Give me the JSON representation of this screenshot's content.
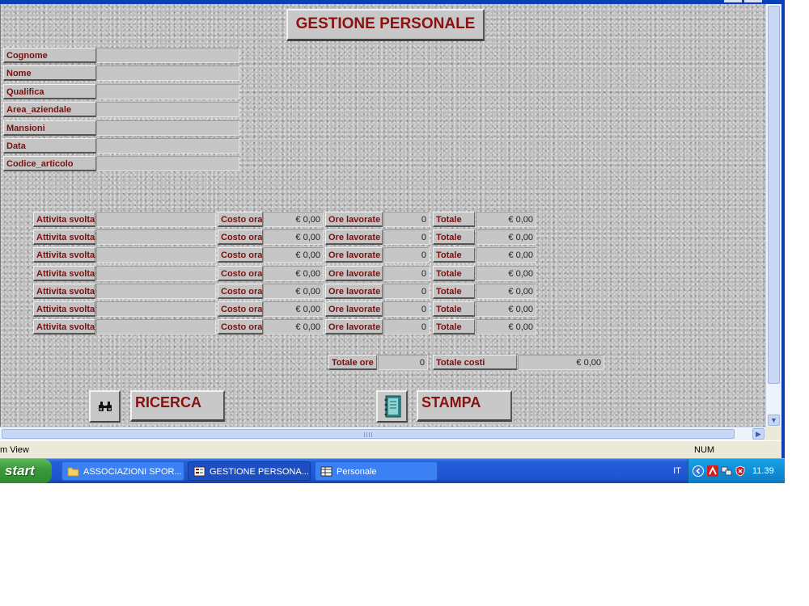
{
  "form": {
    "title": "GESTIONE PERSONALE",
    "fields": [
      {
        "label": "Cognome",
        "value": ""
      },
      {
        "label": "Nome",
        "value": ""
      },
      {
        "label": "Qualifica",
        "value": ""
      },
      {
        "label": "Area_aziendale",
        "value": ""
      },
      {
        "label": "Mansioni",
        "value": ""
      },
      {
        "label": "Data",
        "value": ""
      },
      {
        "label": "Codice_articolo",
        "value": ""
      }
    ],
    "activities": [
      {
        "activity_label": "Attivita svolta",
        "activity_value": "",
        "cost_label": "Costo ora",
        "cost_value": "€ 0,00",
        "hours_label": "Ore lavorate",
        "hours_value": "0",
        "total_label": "Totale",
        "total_value": "€ 0,00"
      },
      {
        "activity_label": "Attivita svolta",
        "activity_value": "",
        "cost_label": "Costo ora",
        "cost_value": "€ 0,00",
        "hours_label": "Ore lavorate",
        "hours_value": "0",
        "total_label": "Totale",
        "total_value": "€ 0,00"
      },
      {
        "activity_label": "Attivita svolta",
        "activity_value": "",
        "cost_label": "Costo ora",
        "cost_value": "€ 0,00",
        "hours_label": "Ore lavorate",
        "hours_value": "0",
        "total_label": "Totale",
        "total_value": "€ 0,00"
      },
      {
        "activity_label": "Attivita svolta",
        "activity_value": "",
        "cost_label": "Costo ora",
        "cost_value": "€ 0,00",
        "hours_label": "Ore lavorate",
        "hours_value": "0",
        "total_label": "Totale",
        "total_value": "€ 0,00"
      },
      {
        "activity_label": "Attivita svolta",
        "activity_value": "",
        "cost_label": "Costo ora",
        "cost_value": "€ 0,00",
        "hours_label": "Ore lavorate",
        "hours_value": "0",
        "total_label": "Totale",
        "total_value": "€ 0,00"
      },
      {
        "activity_label": "Attivita svolta",
        "activity_value": "",
        "cost_label": "Costo ora",
        "cost_value": "€ 0,00",
        "hours_label": "Ore lavorate",
        "hours_value": "0",
        "total_label": "Totale",
        "total_value": "€ 0,00"
      },
      {
        "activity_label": "Attivita svolta",
        "activity_value": "",
        "cost_label": "Costo ora",
        "cost_value": "€ 0,00",
        "hours_label": "Ore lavorate",
        "hours_value": "0",
        "total_label": "Totale",
        "total_value": "€ 0,00"
      }
    ],
    "totals": {
      "hours_label": "Totale ore",
      "hours_value": "0",
      "costs_label": "Totale costi",
      "costs_value": "€ 0,00"
    },
    "buttons": {
      "search_label": "RICERCA",
      "search_icon": "binoculars-icon",
      "print_label": "STAMPA",
      "print_icon": "notebook-icon"
    }
  },
  "status_bar": {
    "left_text": "m View",
    "num_indicator": "NUM"
  },
  "taskbar": {
    "start_label": "start",
    "tasks": [
      {
        "label": "ASSOCIAZIONI SPOR...",
        "icon": "folder-icon",
        "active": false
      },
      {
        "label": "GESTIONE PERSONA...",
        "icon": "form-icon",
        "active": true
      },
      {
        "label": "Personale",
        "icon": "table-icon",
        "active": false
      }
    ],
    "language": "IT",
    "clock": "11.39"
  },
  "colors": {
    "label_text": "#7a0f0f",
    "taskbar_blue": "#245edb",
    "start_green": "#3c9a3c",
    "tray_blue": "#0f8ed8"
  }
}
